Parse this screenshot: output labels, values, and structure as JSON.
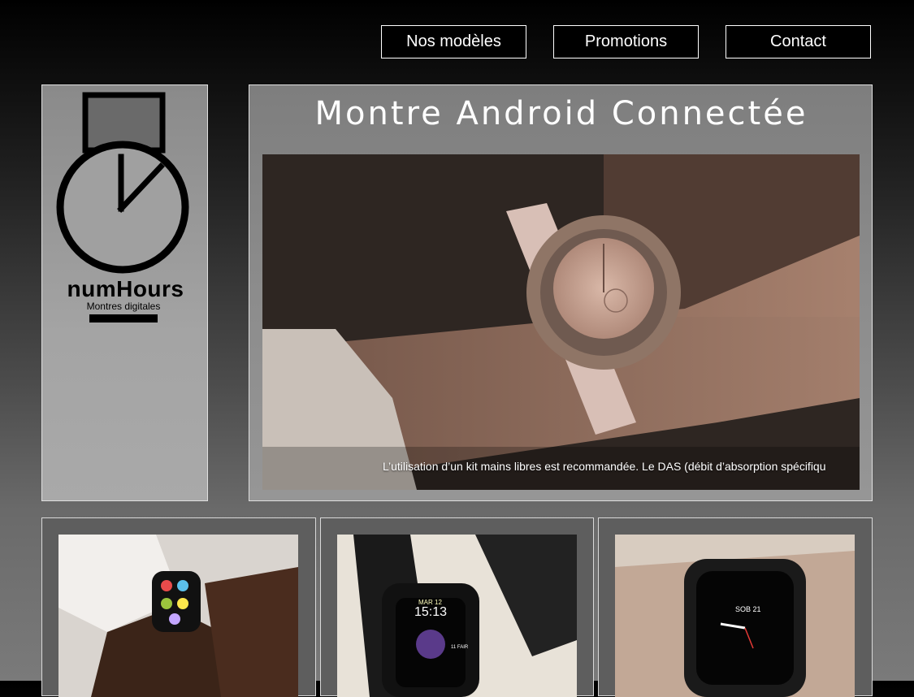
{
  "nav": {
    "items": [
      {
        "label": "Nos modèles"
      },
      {
        "label": "Promotions"
      },
      {
        "label": "Contact"
      }
    ]
  },
  "logo": {
    "name": "numHours",
    "tagline": "Montres digitales",
    "icon": "watch-logo-icon"
  },
  "hero": {
    "title": "Montre Android Connectée",
    "caption": "L’utilisation d’un kit mains libres est recommandée. Le DAS (débit d’absorption spécifiqu",
    "image_icon": "smartwatch-on-wrist-photo"
  },
  "cards": {
    "watch2": {
      "time": "15:13",
      "date": "11 FAIR",
      "day": "MAR 12"
    },
    "watch3": {
      "date": "SOB 21"
    }
  },
  "colors": {
    "nav_bg": "#000000",
    "nav_border": "#ffffff",
    "panel_border": "#e0e0e0"
  }
}
